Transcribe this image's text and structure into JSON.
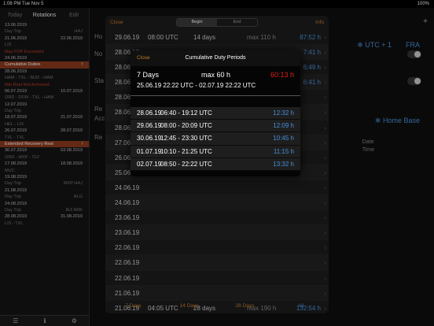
{
  "status": {
    "time": "1:08 PM",
    "date": "Tue Nov 5",
    "battery": "100%"
  },
  "sidebar": {
    "tabs": [
      "Today",
      "Rotations",
      "Edit"
    ],
    "items": [
      {
        "left": "13.06.2019",
        "right": "",
        "style": ""
      },
      {
        "left": "Day Trip",
        "right": "HAJ",
        "style": "sub"
      },
      {
        "left": "21.06.2019",
        "right": "22.06.2019",
        "style": ""
      },
      {
        "left": "LIS",
        "right": "",
        "style": "sub"
      },
      {
        "left": "Max FDP Exceeded",
        "right": "",
        "style": "red"
      },
      {
        "left": "24.06.2019",
        "right": "",
        "style": ""
      },
      {
        "left": "Cumulative Duties",
        "right": "!",
        "style": "hl"
      },
      {
        "left": "28.06.2019",
        "right": "",
        "style": ""
      },
      {
        "left": "HAM - TXL - BUD - HAM",
        "right": "",
        "style": "sub"
      },
      {
        "left": "Min Rest Not Achieved",
        "right": "",
        "style": "red"
      },
      {
        "left": "06.07.2019",
        "right": "10.07.2019",
        "style": ""
      },
      {
        "left": "ORD - DFW - TXL - HAM",
        "right": "",
        "style": "sub"
      },
      {
        "left": "12.07.2019",
        "right": "",
        "style": ""
      },
      {
        "left": "Day Trip",
        "right": "",
        "style": "sub"
      },
      {
        "left": "18.07.2019",
        "right": "21.07.2019",
        "style": ""
      },
      {
        "left": "HEL - LIS",
        "right": "",
        "style": "sub"
      },
      {
        "left": "26.07.2019",
        "right": "28.07.2019",
        "style": ""
      },
      {
        "left": "TXL - TXL",
        "right": "",
        "style": "sub"
      },
      {
        "left": "Extended Recovery Rest",
        "right": "!",
        "style": "hl"
      },
      {
        "left": "30.07.2019",
        "right": "03.08.2019",
        "style": ""
      },
      {
        "left": "ORD - MXP - TLV",
        "right": "",
        "style": "sub"
      },
      {
        "left": "17.08.2019",
        "right": "18.08.2019",
        "style": ""
      },
      {
        "left": "MUC",
        "right": "",
        "style": "sub"
      },
      {
        "left": "19.08.2019",
        "right": "",
        "style": ""
      },
      {
        "left": "Day Trip",
        "right": "MXP HAJ",
        "style": "sub"
      },
      {
        "left": "21.08.2019",
        "right": "",
        "style": ""
      },
      {
        "left": "Day Trip",
        "right": "ALG",
        "style": "sub"
      },
      {
        "left": "24.08.2019",
        "right": "",
        "style": ""
      },
      {
        "left": "Day Trip",
        "right": "IEZ ARK",
        "style": "sub"
      },
      {
        "left": "28.08.2019",
        "right": "31.08.2019",
        "style": ""
      },
      {
        "left": "LIS - TXL",
        "right": "",
        "style": "sub"
      }
    ],
    "bottom_icons": [
      "list-icon",
      "info-icon",
      "settings-icon"
    ]
  },
  "right_panel": {
    "labels": [
      "Ho",
      "No",
      "Sta",
      "Re",
      "Acc",
      "Re"
    ],
    "utc": "UTC + 1",
    "fra": "FRA",
    "home_base": "Home Base",
    "date_label": "Date",
    "time_label": "Time"
  },
  "sheet": {
    "close": "Close",
    "info": "Info",
    "segments": [
      "Begin",
      "End"
    ],
    "active_segment": "Begin",
    "rows": [
      {
        "date": "29.06.19",
        "time": "08:00 UTC",
        "span": "14 days",
        "max": "max  110 h",
        "hours": "87:52 h"
      },
      {
        "date": "28.06.19",
        "time": "",
        "span": "",
        "max": "",
        "hours": "7:41 h"
      },
      {
        "date": "28.06.19",
        "time": "",
        "span": "",
        "max": "",
        "hours": "6:49 h"
      },
      {
        "date": "28.06.19",
        "time": "",
        "span": "",
        "max": "",
        "hours": "6:41 h"
      },
      {
        "date": "28.06.19",
        "time": "",
        "span": "",
        "max": "",
        "hours": ""
      },
      {
        "date": "28.06.19",
        "time": "",
        "span": "",
        "max": "",
        "hours": ""
      },
      {
        "date": "28.06.19",
        "time": "",
        "span": "",
        "max": "",
        "hours": ""
      },
      {
        "date": "27.06.19",
        "time": "",
        "span": "",
        "max": "",
        "hours": ""
      },
      {
        "date": "26.06.19",
        "time": "",
        "span": "",
        "max": "",
        "hours": ""
      },
      {
        "date": "25.06.19",
        "time": "",
        "span": "",
        "max": "",
        "hours": ""
      },
      {
        "date": "24.06.19",
        "time": "",
        "span": "",
        "max": "",
        "hours": ""
      },
      {
        "date": "24.06.19",
        "time": "",
        "span": "",
        "max": "",
        "hours": ""
      },
      {
        "date": "23.06.19",
        "time": "",
        "span": "",
        "max": "",
        "hours": ""
      },
      {
        "date": "23.06.19",
        "time": "",
        "span": "",
        "max": "",
        "hours": ""
      },
      {
        "date": "22.06.19",
        "time": "",
        "span": "",
        "max": "",
        "hours": ""
      },
      {
        "date": "22.06.19",
        "time": "",
        "span": "",
        "max": "",
        "hours": ""
      },
      {
        "date": "22.06.19",
        "time": "",
        "span": "",
        "max": "",
        "hours": ""
      },
      {
        "date": "21.06.19",
        "time": "",
        "span": "",
        "max": "",
        "hours": ""
      },
      {
        "date": "21.06.19",
        "time": "04:05 UTC",
        "span": "28 days",
        "max": "max  190 h",
        "hours": "132:54 h"
      }
    ],
    "footer": [
      "7 Days",
      "14 Days",
      "28 Days",
      "All"
    ],
    "active_footer": "All"
  },
  "popup": {
    "close": "Close",
    "title": "Cumulative Duty Periods",
    "summary_days": "7 Days",
    "summary_max": "max 60 h",
    "summary_total": "60:13 h",
    "summary_range": "25.06.19 22:22 UTC  -  02.07.19 22:22 UTC",
    "rows": [
      {
        "date": "28.06.19",
        "times": "06:40  -  19:12 UTC",
        "hours": "12:32 h"
      },
      {
        "date": "29.06.19",
        "times": "08:00  -  20:09 UTC",
        "hours": "12:09 h"
      },
      {
        "date": "30.06.19",
        "times": "12:45  -  23:30 UTC",
        "hours": "10:45 h"
      },
      {
        "date": "01.07.19",
        "times": "10:10  -  21:25 UTC",
        "hours": "11:15 h"
      },
      {
        "date": "02.07.19",
        "times": "08:50  -  22:22 UTC",
        "hours": "13:32 h"
      }
    ]
  },
  "colors": {
    "accent_orange": "#c47a2a",
    "accent_blue": "#4a90d9",
    "alert_red": "#e0201a",
    "highlight": "#8a3a1e"
  }
}
